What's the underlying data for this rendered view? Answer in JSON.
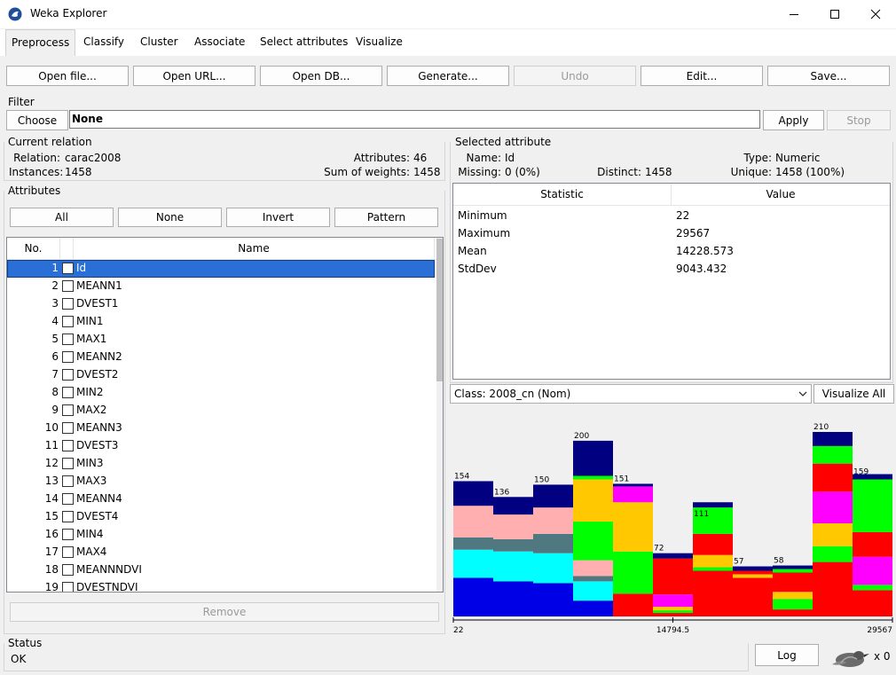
{
  "window": {
    "title": "Weka Explorer"
  },
  "tabs": [
    "Preprocess",
    "Classify",
    "Cluster",
    "Associate",
    "Select attributes",
    "Visualize"
  ],
  "toolbar": {
    "open_file": "Open file...",
    "open_url": "Open URL...",
    "open_db": "Open DB...",
    "generate": "Generate...",
    "undo": "Undo",
    "edit": "Edit...",
    "save": "Save..."
  },
  "filter": {
    "label": "Filter",
    "choose": "Choose",
    "value": "None",
    "apply": "Apply",
    "stop": "Stop"
  },
  "relation": {
    "label": "Current relation",
    "relation_label": "Relation:",
    "relation_value": "carac2008",
    "instances_label": "Instances:",
    "instances_value": "1458",
    "attributes_label": "Attributes:",
    "attributes_value": "46",
    "weights_label": "Sum of weights:",
    "weights_value": "1458"
  },
  "attributes": {
    "label": "Attributes",
    "buttons": {
      "all": "All",
      "none": "None",
      "invert": "Invert",
      "pattern": "Pattern"
    },
    "col_no": "No.",
    "col_name": "Name",
    "rows": [
      {
        "no": "1",
        "name": "Id"
      },
      {
        "no": "2",
        "name": "MEANN1"
      },
      {
        "no": "3",
        "name": "DVEST1"
      },
      {
        "no": "4",
        "name": "MIN1"
      },
      {
        "no": "5",
        "name": "MAX1"
      },
      {
        "no": "6",
        "name": "MEANN2"
      },
      {
        "no": "7",
        "name": "DVEST2"
      },
      {
        "no": "8",
        "name": "MIN2"
      },
      {
        "no": "9",
        "name": "MAX2"
      },
      {
        "no": "10",
        "name": "MEANN3"
      },
      {
        "no": "11",
        "name": "DVEST3"
      },
      {
        "no": "12",
        "name": "MIN3"
      },
      {
        "no": "13",
        "name": "MAX3"
      },
      {
        "no": "14",
        "name": "MEANN4"
      },
      {
        "no": "15",
        "name": "DVEST4"
      },
      {
        "no": "16",
        "name": "MIN4"
      },
      {
        "no": "17",
        "name": "MAX4"
      },
      {
        "no": "18",
        "name": "MEANNNDVI"
      },
      {
        "no": "19",
        "name": "DVESTNDVI"
      }
    ],
    "remove": "Remove"
  },
  "selected": {
    "label": "Selected attribute",
    "name_label": "Name:",
    "name_value": "Id",
    "type_label": "Type:",
    "type_value": "Numeric",
    "missing_label": "Missing:",
    "missing_value": "0 (0%)",
    "distinct_label": "Distinct:",
    "distinct_value": "1458",
    "unique_label": "Unique:",
    "unique_value": "1458 (100%)",
    "col_statistic": "Statistic",
    "col_value": "Value",
    "stats": [
      {
        "name": "Minimum",
        "value": "22"
      },
      {
        "name": "Maximum",
        "value": "29567"
      },
      {
        "name": "Mean",
        "value": "14228.573"
      },
      {
        "name": "StdDev",
        "value": "9043.432"
      }
    ]
  },
  "class_select": {
    "value": "Class: 2008_cn (Nom)",
    "visualize_all": "Visualize All"
  },
  "status": {
    "label": "Status",
    "text": "OK",
    "log": "Log",
    "count": "x 0"
  },
  "chart_data": {
    "type": "bar",
    "stacked": true,
    "x_axis_labels": [
      "22",
      "14794.5",
      "29567"
    ],
    "bin_totals": [
      154,
      136,
      150,
      200,
      151,
      72,
      111,
      57,
      58,
      210,
      159
    ],
    "segments": [
      [
        {
          "c": "#0000e6",
          "v": 44
        },
        {
          "c": "#00ffff",
          "v": 32
        },
        {
          "c": "#507880",
          "v": 14
        },
        {
          "c": "#ffafaf",
          "v": 36
        },
        {
          "c": "#000080",
          "v": 28
        }
      ],
      [
        {
          "c": "#0000e6",
          "v": 40
        },
        {
          "c": "#00ffff",
          "v": 34
        },
        {
          "c": "#507880",
          "v": 14
        },
        {
          "c": "#ffafaf",
          "v": 28
        },
        {
          "c": "#000080",
          "v": 20
        }
      ],
      [
        {
          "c": "#0000e6",
          "v": 38
        },
        {
          "c": "#00ffff",
          "v": 34
        },
        {
          "c": "#507880",
          "v": 22
        },
        {
          "c": "#ffafaf",
          "v": 30
        },
        {
          "c": "#000080",
          "v": 26
        }
      ],
      [
        {
          "c": "#0000e6",
          "v": 18
        },
        {
          "c": "#00ffff",
          "v": 22
        },
        {
          "c": "#507880",
          "v": 6
        },
        {
          "c": "#ffafaf",
          "v": 18
        },
        {
          "c": "#00ff00",
          "v": 44
        },
        {
          "c": "#ffc800",
          "v": 48
        },
        {
          "c": "#00ff00",
          "v": 4
        },
        {
          "c": "#000080",
          "v": 40
        }
      ],
      [
        {
          "c": "#ff0000",
          "v": 26
        },
        {
          "c": "#00ff00",
          "v": 48
        },
        {
          "c": "#ffc800",
          "v": 56
        },
        {
          "c": "#ff00ff",
          "v": 18
        },
        {
          "c": "#000080",
          "v": 3
        }
      ],
      [
        {
          "c": "#ff0000",
          "v": 4
        },
        {
          "c": "#00ff00",
          "v": 3
        },
        {
          "c": "#ffc800",
          "v": 4
        },
        {
          "c": "#ff00ff",
          "v": 14
        },
        {
          "c": "#ff0000",
          "v": 41
        },
        {
          "c": "#000080",
          "v": 6
        }
      ],
      [
        {
          "c": "#ff0000",
          "v": 52
        },
        {
          "c": "#00ff00",
          "v": 4
        },
        {
          "c": "#ffc800",
          "v": 14
        },
        {
          "c": "#ff0000",
          "v": 24
        },
        {
          "c": "#00ff00",
          "v": 30
        },
        {
          "c": "#000080",
          "v": 6
        }
      ],
      [
        {
          "c": "#ff0000",
          "v": 44
        },
        {
          "c": "#ffc800",
          "v": 4
        },
        {
          "c": "#ff0000",
          "v": 4
        },
        {
          "c": "#000080",
          "v": 5
        }
      ],
      [
        {
          "c": "#ff0000",
          "v": 8
        },
        {
          "c": "#00ff00",
          "v": 12
        },
        {
          "c": "#ffc800",
          "v": 8
        },
        {
          "c": "#ff0000",
          "v": 22
        },
        {
          "c": "#00ff00",
          "v": 4
        },
        {
          "c": "#000080",
          "v": 4
        }
      ],
      [
        {
          "c": "#ff0000",
          "v": 62
        },
        {
          "c": "#00ff00",
          "v": 18
        },
        {
          "c": "#ffc800",
          "v": 26
        },
        {
          "c": "#ff00ff",
          "v": 36
        },
        {
          "c": "#ff0000",
          "v": 32
        },
        {
          "c": "#00ff00",
          "v": 20
        },
        {
          "c": "#000080",
          "v": 16
        }
      ],
      [
        {
          "c": "#ff0000",
          "v": 30
        },
        {
          "c": "#00ff00",
          "v": 6
        },
        {
          "c": "#ff00ff",
          "v": 32
        },
        {
          "c": "#ff0000",
          "v": 28
        },
        {
          "c": "#00ff00",
          "v": 60
        },
        {
          "c": "#000080",
          "v": 6
        }
      ]
    ]
  }
}
